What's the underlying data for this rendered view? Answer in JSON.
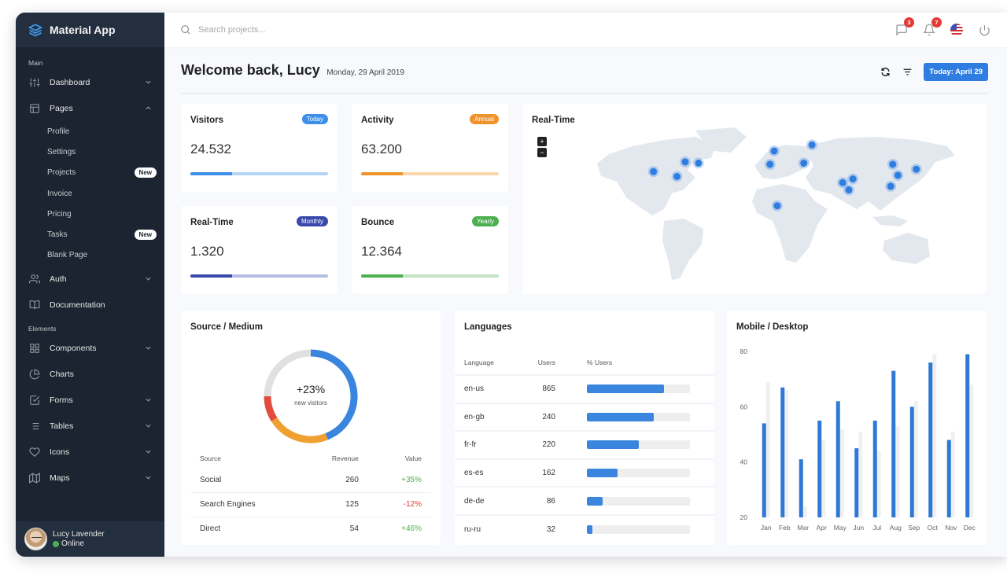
{
  "app": {
    "name": "Material App"
  },
  "sidebar": {
    "sections": [
      {
        "label": "Main"
      },
      {
        "label": "Elements"
      }
    ],
    "items": [
      {
        "label": "Dashboard",
        "icon": "sliders-icon",
        "chevron": "down"
      },
      {
        "label": "Pages",
        "icon": "layout-icon",
        "chevron": "up",
        "children": [
          {
            "label": "Profile"
          },
          {
            "label": "Settings"
          },
          {
            "label": "Projects",
            "badge": "New"
          },
          {
            "label": "Invoice"
          },
          {
            "label": "Pricing"
          },
          {
            "label": "Tasks",
            "badge": "New"
          },
          {
            "label": "Blank Page"
          }
        ]
      },
      {
        "label": "Auth",
        "icon": "users-icon",
        "chevron": "down"
      },
      {
        "label": "Documentation",
        "icon": "book-icon"
      },
      {
        "label": "Components",
        "icon": "grid-icon",
        "chevron": "down"
      },
      {
        "label": "Charts",
        "icon": "pie-chart-icon"
      },
      {
        "label": "Forms",
        "icon": "check-square-icon",
        "chevron": "down"
      },
      {
        "label": "Tables",
        "icon": "list-icon",
        "chevron": "down"
      },
      {
        "label": "Icons",
        "icon": "heart-icon",
        "chevron": "down"
      },
      {
        "label": "Maps",
        "icon": "map-icon",
        "chevron": "down"
      }
    ],
    "user": {
      "name": "Lucy Lavender",
      "status": "Online"
    }
  },
  "topbar": {
    "search_placeholder": "Search projects...",
    "messages_count": "3",
    "notifications_count": "7",
    "language_flag": "us-flag"
  },
  "header": {
    "title": "Welcome back, Lucy",
    "date": "Monday, 29 April 2019",
    "today_button": "Today: April 29"
  },
  "stats": [
    {
      "title": "Visitors",
      "value": "24.532",
      "pill": "Today",
      "color": "#3d8ee8",
      "track": "#b3d4f7",
      "progress": 30
    },
    {
      "title": "Activity",
      "value": "63.200",
      "pill": "Annual",
      "color": "#f0932b",
      "track": "#fbd6a8",
      "progress": 30
    },
    {
      "title": "Real-Time",
      "value": "1.320",
      "pill": "Monthly",
      "color": "#3949ab",
      "track": "#b6bde3",
      "progress": 30
    },
    {
      "title": "Bounce",
      "value": "12.364",
      "pill": "Yearly",
      "color": "#4caf50",
      "track": "#c3e3c4",
      "progress": 30
    }
  ],
  "map": {
    "title": "Real-Time",
    "zoom_in": "+",
    "zoom_out": "−",
    "markers": [
      {
        "name": "Los Angeles",
        "lon": -118,
        "lat": 34
      },
      {
        "name": "Houston",
        "lon": -95,
        "lat": 30
      },
      {
        "name": "Chicago",
        "lon": -87,
        "lat": 42
      },
      {
        "name": "New York",
        "lon": -74,
        "lat": 41
      },
      {
        "name": "London",
        "lon": 0,
        "lat": 51
      },
      {
        "name": "Madrid",
        "lon": -4,
        "lat": 40
      },
      {
        "name": "Lagos",
        "lon": 3,
        "lat": 6
      },
      {
        "name": "Moscow",
        "lon": 37,
        "lat": 56
      },
      {
        "name": "Istanbul",
        "lon": 29,
        "lat": 41
      },
      {
        "name": "Karachi",
        "lon": 67,
        "lat": 25
      },
      {
        "name": "Delhi",
        "lon": 77,
        "lat": 28
      },
      {
        "name": "Mumbai",
        "lon": 73,
        "lat": 19
      },
      {
        "name": "Beijing",
        "lon": 116,
        "lat": 40
      },
      {
        "name": "Shanghai",
        "lon": 121,
        "lat": 31
      },
      {
        "name": "Hong Kong",
        "lon": 114,
        "lat": 22
      },
      {
        "name": "Tokyo",
        "lon": 139,
        "lat": 36
      }
    ]
  },
  "source_medium": {
    "title": "Source / Medium",
    "center_value": "+23%",
    "center_label": "new visitors",
    "donut": [
      {
        "color": "#3a85dd",
        "share": 44
      },
      {
        "color": "#f0a030",
        "share": 22
      },
      {
        "color": "#e24c3f",
        "share": 9
      },
      {
        "color": "#e0e0e0",
        "share": 25
      }
    ],
    "columns": [
      "Source",
      "Revenue",
      "Value"
    ],
    "rows": [
      {
        "source": "Social",
        "revenue": "260",
        "value": "+35%",
        "trend": "up"
      },
      {
        "source": "Search Engines",
        "revenue": "125",
        "value": "-12%",
        "trend": "down"
      },
      {
        "source": "Direct",
        "revenue": "54",
        "value": "+46%",
        "trend": "up"
      }
    ]
  },
  "languages": {
    "title": "Languages",
    "columns": [
      "Language",
      "Users",
      "% Users"
    ],
    "rows": [
      {
        "language": "en-us",
        "users": "865",
        "percent": 75
      },
      {
        "language": "en-gb",
        "users": "240",
        "percent": 65
      },
      {
        "language": "fr-fr",
        "users": "220",
        "percent": 50
      },
      {
        "language": "es-es",
        "users": "162",
        "percent": 30
      },
      {
        "language": "de-de",
        "users": "86",
        "percent": 15
      },
      {
        "language": "ru-ru",
        "users": "32",
        "percent": 5
      }
    ]
  },
  "chart_data": {
    "type": "bar",
    "title": "Mobile / Desktop",
    "categories": [
      "Jan",
      "Feb",
      "Mar",
      "Apr",
      "May",
      "Jun",
      "Jul",
      "Aug",
      "Sep",
      "Oct",
      "Nov",
      "Dec"
    ],
    "series": [
      {
        "name": "Mobile",
        "color": "#2f78d6",
        "values": [
          54,
          67,
          41,
          55,
          62,
          45,
          55,
          73,
          60,
          76,
          48,
          79
        ]
      },
      {
        "name": "Desktop",
        "color": "#f0f0f0",
        "values": [
          69,
          66,
          24,
          48,
          52,
          51,
          44,
          53,
          62,
          79,
          51,
          68
        ]
      }
    ],
    "yticks": [
      20,
      40,
      60,
      80
    ],
    "ylim": [
      20,
      80
    ],
    "xlabel": "",
    "ylabel": "",
    "grid": false,
    "legend": "none"
  }
}
